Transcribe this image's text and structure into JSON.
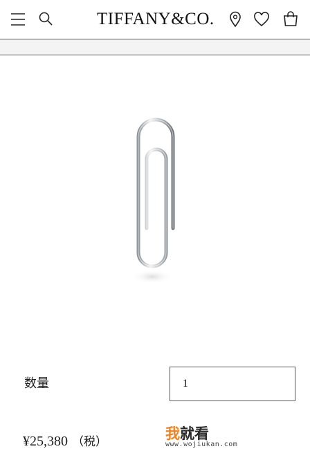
{
  "header": {
    "brand": "TIFFANY&CO.",
    "icons": [
      "menu-icon",
      "search-icon",
      "location-icon",
      "heart-icon",
      "bag-icon"
    ]
  },
  "product": {
    "image": "paperclip",
    "quantity_label": "数量",
    "quantity_value": "1",
    "price": "¥25,380",
    "tax_note": "（税）"
  },
  "watermark": {
    "accent_char": "我",
    "rest_chars": "就看",
    "url": "www.wojiukan.com",
    "accent_color": "#e8842a"
  }
}
